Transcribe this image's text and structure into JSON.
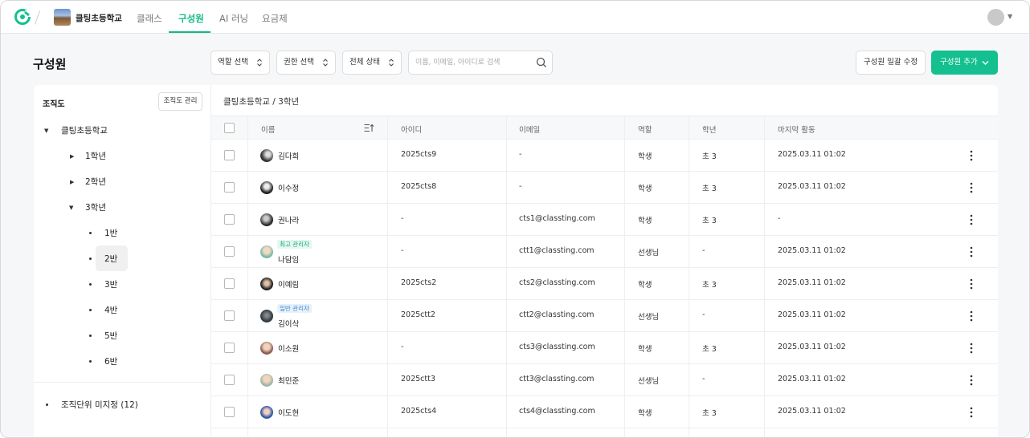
{
  "nav": {
    "school_name": "클팅초등학교",
    "tabs": [
      {
        "label": "클래스",
        "active": false
      },
      {
        "label": "구성원",
        "active": true
      },
      {
        "label": "AI 러닝",
        "active": false
      },
      {
        "label": "요금제",
        "active": false
      }
    ],
    "accent_color": "#14b88a"
  },
  "header": {
    "title": "구성원",
    "filters": [
      "역할 선택",
      "권한 선택",
      "전체 상태"
    ],
    "search_placeholder": "이름, 이메일, 아이디로 검색",
    "bulk_edit_label": "구성원 일괄 수정",
    "add_label": "구성원 추가"
  },
  "tree": {
    "title": "조직도",
    "manage_label": "조직도 관리",
    "root": "클팅초등학교",
    "grades": [
      "1학년",
      "2학년",
      "3학년"
    ],
    "classes": [
      "1반",
      "2반",
      "3반",
      "4반",
      "5반",
      "6반"
    ],
    "selected": "2반",
    "unassigned": "조직단위 미지정 (12)"
  },
  "table": {
    "breadcrumb": "클팅초등학교 / 3학년",
    "columns": [
      "이름",
      "아이디",
      "이메일",
      "역할",
      "학년",
      "마지막 활동"
    ],
    "rows": [
      {
        "name": "김다희",
        "badge": "",
        "id": "2025cts9",
        "email": "-",
        "role": "학생",
        "grade": "초 3",
        "last": "2025.03.11 01:02"
      },
      {
        "name": "이수정",
        "badge": "",
        "id": "2025cts8",
        "email": "-",
        "role": "학생",
        "grade": "초 3",
        "last": "2025.03.11 01:02"
      },
      {
        "name": "권나라",
        "badge": "",
        "id": "-",
        "email": "cts1@classting.com",
        "role": "학생",
        "grade": "초 3",
        "last": "-"
      },
      {
        "name": "나담임",
        "badge": "최고 관리자",
        "id": "-",
        "email": "ctt1@classting.com",
        "role": "선생님",
        "grade": "-",
        "last": "2025.03.11 01:02"
      },
      {
        "name": "이예림",
        "badge": "",
        "id": "2025cts2",
        "email": "cts2@classting.com",
        "role": "학생",
        "grade": "초 3",
        "last": "2025.03.11 01:02"
      },
      {
        "name": "김이삭",
        "badge": "일반 관리자",
        "id": "2025ctt2",
        "email": "ctt2@classting.com",
        "role": "선생님",
        "grade": "-",
        "last": "2025.03.11 01:02"
      },
      {
        "name": "이소원",
        "badge": "",
        "id": "-",
        "email": "cts3@classting.com",
        "role": "학생",
        "grade": "초 3",
        "last": "2025.03.11 01:02"
      },
      {
        "name": "최민준",
        "badge": "",
        "id": "2025ctt3",
        "email": "ctt3@classting.com",
        "role": "선생님",
        "grade": "-",
        "last": "2025.03.11 01:02"
      },
      {
        "name": "이도현",
        "badge": "",
        "id": "2025cts4",
        "email": "cts4@classting.com",
        "role": "학생",
        "grade": "초 3",
        "last": "2025.03.11 01:02"
      }
    ]
  }
}
